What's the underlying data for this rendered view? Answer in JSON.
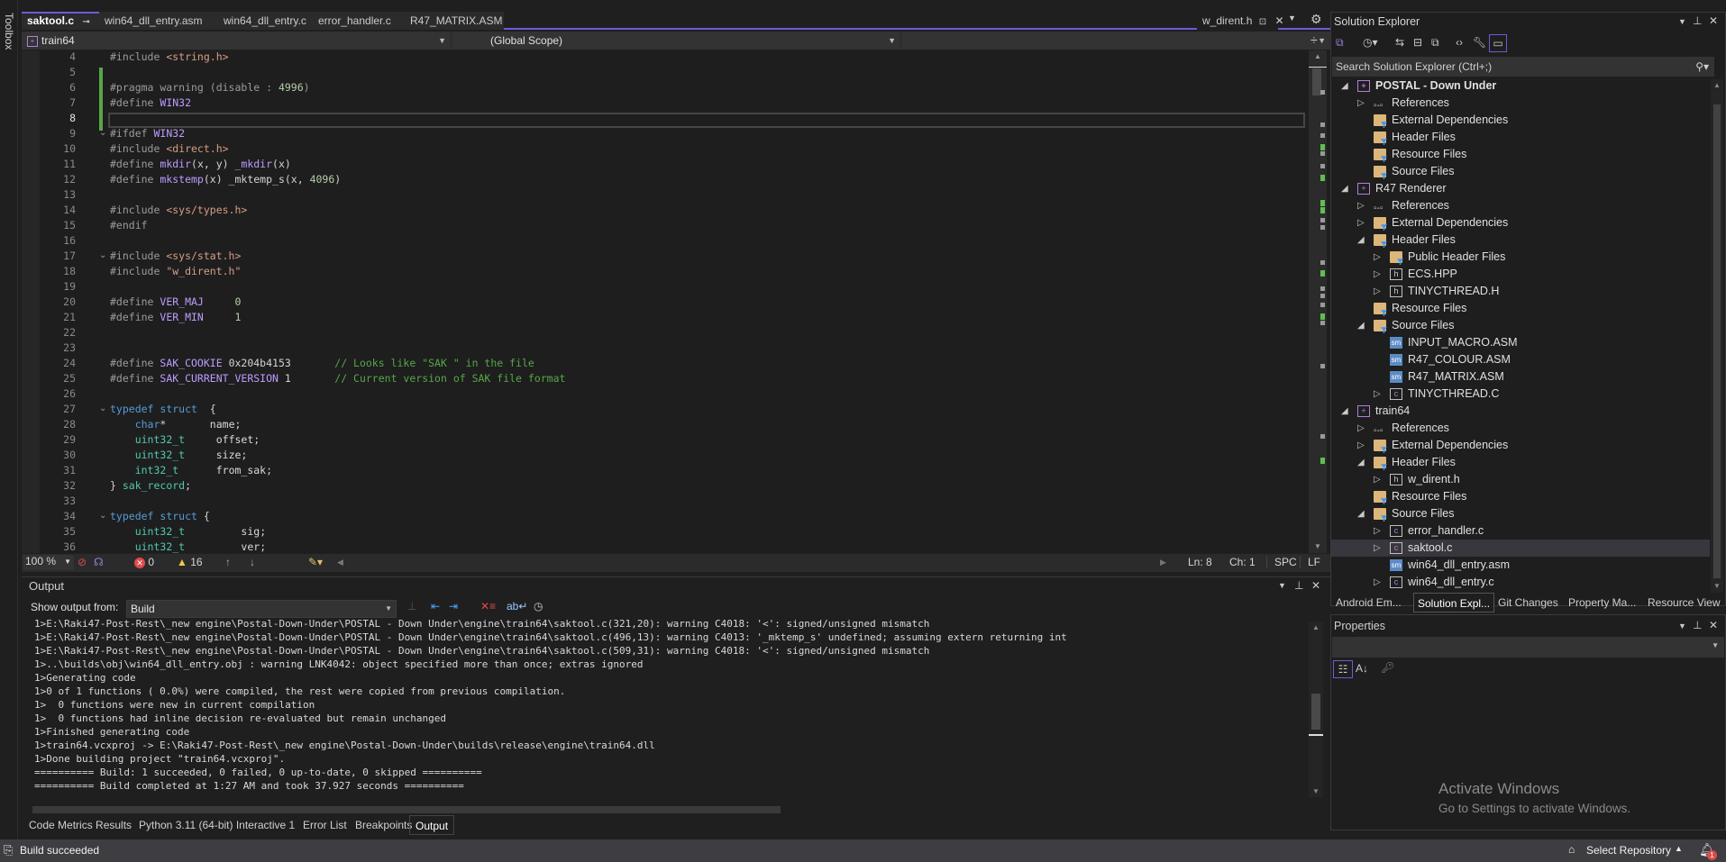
{
  "toolbox_label": "Toolbox",
  "editor": {
    "tabs": [
      {
        "label": "saktool.c",
        "active": true,
        "pinned": true
      },
      {
        "label": "win64_dll_entry.asm"
      },
      {
        "label": "win64_dll_entry.c"
      },
      {
        "label": "error_handler.c"
      },
      {
        "label": "R47_MATRIX.ASM"
      }
    ],
    "preview_tab": "w_dirent.h",
    "project_dropdown": "train64",
    "scope_dropdown": "(Global Scope)",
    "member_dropdown": "",
    "current_line": 8,
    "lines": [
      {
        "n": "4",
        "html": "<span class='pp'>#include </span><span class='str'>&lt;string.h&gt;</span>"
      },
      {
        "n": "5",
        "html": ""
      },
      {
        "n": "6",
        "html": "<span class='pp'>#pragma warning (disable : </span><span class='num'>4996</span><span class='pp'>)</span>"
      },
      {
        "n": "7",
        "html": "<span class='pp'>#define </span><span class='mac'>WIN32</span>"
      },
      {
        "n": "8",
        "html": ""
      },
      {
        "n": "9",
        "html": "<span class='pp'>#ifdef </span><span class='mac'>WIN32</span>",
        "fold": true
      },
      {
        "n": "10",
        "html": "<span class='pp'>#include </span><span class='str'>&lt;direct.h&gt;</span>"
      },
      {
        "n": "11",
        "html": "<span class='pp'>#define </span><span class='mac'>mkdir</span>(x, y) <span class='mac'>_mkdir</span>(x)"
      },
      {
        "n": "12",
        "html": "<span class='pp'>#define </span><span class='mac'>mkstemp</span>(x) _mktemp_s(x, <span class='num'>4096</span>)"
      },
      {
        "n": "13",
        "html": ""
      },
      {
        "n": "14",
        "html": "<span class='pp'>#include </span><span class='str'>&lt;sys/types.h&gt;</span>"
      },
      {
        "n": "15",
        "html": "<span class='pp'>#endif</span>"
      },
      {
        "n": "16",
        "html": ""
      },
      {
        "n": "17",
        "html": "<span class='pp'>#include </span><span class='str'>&lt;sys/stat.h&gt;</span>",
        "fold": true
      },
      {
        "n": "18",
        "html": "<span class='pp'>#include </span><span class='str'>\"w_dirent.h\"</span>"
      },
      {
        "n": "19",
        "html": ""
      },
      {
        "n": "20",
        "html": "<span class='pp'>#define </span><span class='mac'>VER_MAJ</span>     <span class='num'>0</span>"
      },
      {
        "n": "21",
        "html": "<span class='pp'>#define </span><span class='mac'>VER_MIN</span>     <span class='num'>1</span>"
      },
      {
        "n": "22",
        "html": ""
      },
      {
        "n": "23",
        "html": ""
      },
      {
        "n": "24",
        "html": "<span class='pp'>#define </span><span class='mac'>SAK_COOKIE</span> 0x204b4153       <span class='cmt'>// Looks like \"SAK \" in the file</span>"
      },
      {
        "n": "25",
        "html": "<span class='pp'>#define </span><span class='mac'>SAK_CURRENT_VERSION</span> 1       <span class='cmt'>// Current version of SAK file format</span>"
      },
      {
        "n": "26",
        "html": ""
      },
      {
        "n": "27",
        "html": "<span class='kw'>typedef</span> <span class='kw'>struct</span>  {",
        "fold": true
      },
      {
        "n": "28",
        "html": "    <span class='kw'>char</span>*       <span class='id'>name</span>;"
      },
      {
        "n": "29",
        "html": "    <span class='ty'>uint32_t</span>     <span class='id'>offset</span>;"
      },
      {
        "n": "30",
        "html": "    <span class='ty'>uint32_t</span>     <span class='id'>size</span>;"
      },
      {
        "n": "31",
        "html": "    <span class='ty'>int32_t</span>      <span class='id'>from_sak</span>;"
      },
      {
        "n": "32",
        "html": "} <span class='ty'>sak_record</span>;"
      },
      {
        "n": "33",
        "html": ""
      },
      {
        "n": "34",
        "html": "<span class='kw'>typedef</span> <span class='kw'>struct</span> {",
        "fold": true
      },
      {
        "n": "35",
        "html": "    <span class='ty'>uint32_t</span>         <span class='id'>sig</span>;"
      },
      {
        "n": "36",
        "html": "    <span class='ty'>uint32_t</span>         <span class='id'>ver</span>;"
      }
    ],
    "status": {
      "zoom": "100 %",
      "errors": "0",
      "warnings": "16",
      "ln": "Ln: 8",
      "ch": "Ch: 1",
      "spc": "SPC",
      "lf": "LF"
    }
  },
  "output": {
    "title": "Output",
    "show_from_label": "Show output from:",
    "source": "Build",
    "lines": [
      "1>E:\\Raki47-Post-Rest\\_new engine\\Postal-Down-Under\\POSTAL - Down Under\\engine\\train64\\saktool.c(321,20): warning C4018: '<': signed/unsigned mismatch",
      "1>E:\\Raki47-Post-Rest\\_new engine\\Postal-Down-Under\\POSTAL - Down Under\\engine\\train64\\saktool.c(496,13): warning C4013: '_mktemp_s' undefined; assuming extern returning int",
      "1>E:\\Raki47-Post-Rest\\_new engine\\Postal-Down-Under\\POSTAL - Down Under\\engine\\train64\\saktool.c(509,31): warning C4018: '<': signed/unsigned mismatch",
      "1>..\\builds\\obj\\win64_dll_entry.obj : warning LNK4042: object specified more than once; extras ignored",
      "1>Generating code",
      "1>0 of 1 functions ( 0.0%) were compiled, the rest were copied from previous compilation.",
      "1>  0 functions were new in current compilation",
      "1>  0 functions had inline decision re-evaluated but remain unchanged",
      "1>Finished generating code",
      "1>train64.vcxproj -> E:\\Raki47-Post-Rest\\_new engine\\Postal-Down-Under\\builds\\release\\engine\\train64.dll",
      "1>Done building project \"train64.vcxproj\".",
      "========== Build: 1 succeeded, 0 failed, 0 up-to-date, 0 skipped ==========",
      "========== Build completed at 1:27 AM and took 37.927 seconds =========="
    ]
  },
  "bottom_tabs": [
    {
      "label": "Code Metrics Results"
    },
    {
      "label": "Python 3.11 (64-bit) Interactive 1"
    },
    {
      "label": "Error List"
    },
    {
      "label": "Breakpoints"
    },
    {
      "label": "Output",
      "active": true
    }
  ],
  "status_bar": {
    "message": "Build succeeded",
    "repo": "Select Repository",
    "notifications": "1"
  },
  "solution_explorer": {
    "title": "Solution Explorer",
    "search_placeholder": "Search Solution Explorer (Ctrl+;)",
    "tree": [
      {
        "label": "POSTAL - Down Under",
        "depth": 0,
        "icon": "project",
        "exp": "open",
        "bold": true
      },
      {
        "label": "References",
        "depth": 1,
        "icon": "references",
        "exp": "closed"
      },
      {
        "label": "External Dependencies",
        "depth": 1,
        "icon": "ext",
        "exp": ""
      },
      {
        "label": "Header Files",
        "depth": 1,
        "icon": "filter",
        "exp": ""
      },
      {
        "label": "Resource Files",
        "depth": 1,
        "icon": "filter",
        "exp": ""
      },
      {
        "label": "Source Files",
        "depth": 1,
        "icon": "filter",
        "exp": ""
      },
      {
        "label": "R47 Renderer",
        "depth": 0,
        "icon": "project",
        "exp": "open"
      },
      {
        "label": "References",
        "depth": 1,
        "icon": "references",
        "exp": "closed"
      },
      {
        "label": "External Dependencies",
        "depth": 1,
        "icon": "ext",
        "exp": "closed"
      },
      {
        "label": "Header Files",
        "depth": 1,
        "icon": "filter",
        "exp": "open"
      },
      {
        "label": "Public Header Files",
        "depth": 2,
        "icon": "filter",
        "exp": "closed"
      },
      {
        "label": "ECS.HPP",
        "depth": 2,
        "icon": "h",
        "exp": "closed"
      },
      {
        "label": "TINYCTHREAD.H",
        "depth": 2,
        "icon": "h",
        "exp": "closed"
      },
      {
        "label": "Resource Files",
        "depth": 1,
        "icon": "filter",
        "exp": ""
      },
      {
        "label": "Source Files",
        "depth": 1,
        "icon": "filter",
        "exp": "open"
      },
      {
        "label": "INPUT_MACRO.ASM",
        "depth": 2,
        "icon": "asm",
        "exp": ""
      },
      {
        "label": "R47_COLOUR.ASM",
        "depth": 2,
        "icon": "asm",
        "exp": ""
      },
      {
        "label": "R47_MATRIX.ASM",
        "depth": 2,
        "icon": "asm",
        "exp": ""
      },
      {
        "label": "TINYCTHREAD.C",
        "depth": 2,
        "icon": "c",
        "exp": "closed"
      },
      {
        "label": "train64",
        "depth": 0,
        "icon": "project",
        "exp": "open"
      },
      {
        "label": "References",
        "depth": 1,
        "icon": "references",
        "exp": "closed"
      },
      {
        "label": "External Dependencies",
        "depth": 1,
        "icon": "ext",
        "exp": "closed"
      },
      {
        "label": "Header Files",
        "depth": 1,
        "icon": "filter",
        "exp": "open"
      },
      {
        "label": "w_dirent.h",
        "depth": 2,
        "icon": "h",
        "exp": "closed"
      },
      {
        "label": "Resource Files",
        "depth": 1,
        "icon": "filter",
        "exp": ""
      },
      {
        "label": "Source Files",
        "depth": 1,
        "icon": "filter",
        "exp": "open"
      },
      {
        "label": "error_handler.c",
        "depth": 2,
        "icon": "c",
        "exp": "closed"
      },
      {
        "label": "saktool.c",
        "depth": 2,
        "icon": "c",
        "exp": "closed",
        "selected": true
      },
      {
        "label": "win64_dll_entry.asm",
        "depth": 2,
        "icon": "asm",
        "exp": ""
      },
      {
        "label": "win64_dll_entry.c",
        "depth": 2,
        "icon": "c",
        "exp": "closed"
      }
    ],
    "tabs": [
      {
        "label": "Android Em..."
      },
      {
        "label": "Solution Expl...",
        "active": true
      },
      {
        "label": "Git Changes"
      },
      {
        "label": "Property Ma..."
      },
      {
        "label": "Resource View"
      }
    ]
  },
  "properties": {
    "title": "Properties"
  },
  "watermark": {
    "line1": "Activate Windows",
    "line2": "Go to Settings to activate Windows."
  },
  "colors": {
    "accent": "#6e5ad8",
    "change_bar": "#57a64a",
    "error": "#e04a4a",
    "warning": "#f2c94c"
  }
}
